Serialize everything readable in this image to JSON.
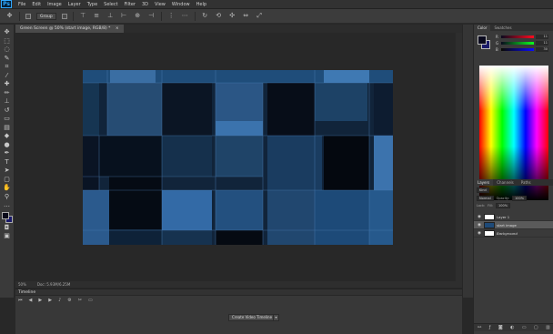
{
  "app": {
    "logo": "Ps"
  },
  "menubar": {
    "items": [
      "File",
      "Edit",
      "Image",
      "Layer",
      "Type",
      "Select",
      "Filter",
      "3D",
      "View",
      "Window",
      "Help"
    ]
  },
  "options_bar": {
    "auto_select_value": "Group"
  },
  "document": {
    "tab_title": "Green Screen @ 50% (start image, RGB/8) *",
    "tab_close": "×"
  },
  "status": {
    "zoom": "50%",
    "doc_info": "Doc: 5.93M/6.25M"
  },
  "timeline": {
    "title": "Timeline",
    "create_button": "Create Video Timeline",
    "create_arrow": "▾"
  },
  "color_panel": {
    "tabs": [
      "Color",
      "Swatches"
    ],
    "sliders": [
      {
        "label": "R",
        "value": "11",
        "gradient": "linear-gradient(to right,#0a0a1e,#ff0a1e)"
      },
      {
        "label": "G",
        "value": "11",
        "gradient": "linear-gradient(to right,#0a0a1e,#0aff1e)"
      },
      {
        "label": "B",
        "value": "30",
        "gradient": "linear-gradient(to right,#0a0a00,#0a0aff)"
      }
    ]
  },
  "layers_panel": {
    "tabs": [
      "Layers",
      "Channels",
      "Paths"
    ],
    "kind_label": "Kind",
    "blend_mode": "Normal",
    "opacity_label": "Opacity:",
    "opacity_value": "100%",
    "lock_label": "Lock:",
    "fill_label": "Fill:",
    "fill_value": "100%",
    "layers": [
      {
        "name": "Layer 1",
        "selected": false,
        "thumb": "#ffffff",
        "italic": false
      },
      {
        "name": "start image",
        "selected": true,
        "thumb": "#1e4a78",
        "italic": false
      },
      {
        "name": "Background",
        "selected": false,
        "thumb": "#ffffff",
        "italic": true
      }
    ]
  }
}
